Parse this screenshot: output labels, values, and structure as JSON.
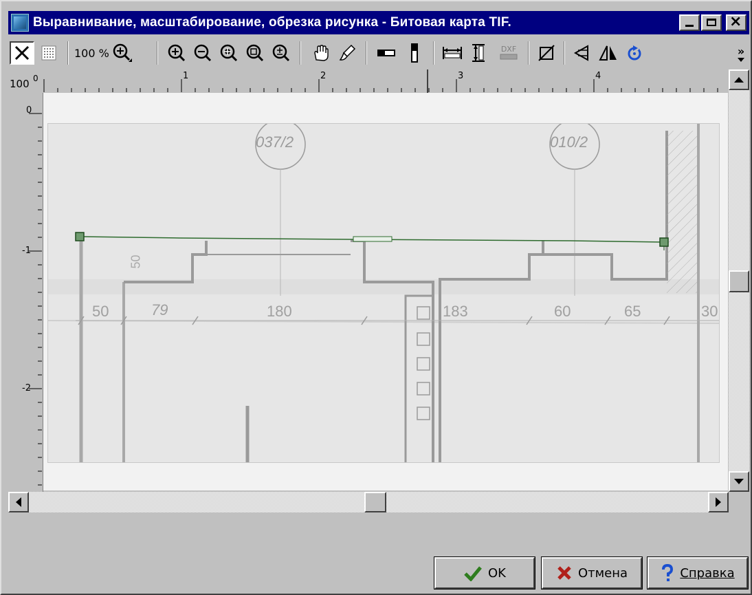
{
  "window": {
    "title": "Выравнивание, масштабирование, обрезка рисунка - Битовая карта TIF."
  },
  "toolbar": {
    "zoom_label": "100 %",
    "dxf_label": "DXF",
    "tools": [
      "cross-tool",
      "grid-tool",
      "zoom-100-tool",
      "zoom-in-tool",
      "zoom-out-tool",
      "zoom-fit-tool",
      "zoom-window-tool",
      "zoom-plusminus-tool",
      "pan-hand-tool",
      "brush-tool",
      "horizontal-align-tool",
      "vertical-align-tool",
      "horizontal-measure-tool",
      "vertical-measure-tool",
      "dxf-tool",
      "crop-tool",
      "mirror-vertical-tool",
      "mirror-horizontal-tool",
      "rotate-tool"
    ],
    "overflow_label": "»"
  },
  "ruler": {
    "corner_label": "100",
    "corner_sub": "0",
    "h_labels": [
      "1",
      "2",
      "3",
      "4"
    ],
    "v_labels": [
      "0",
      "-1",
      "-2"
    ]
  },
  "drawing": {
    "bubble_labels": [
      "037/2",
      "010/2"
    ],
    "dimension_labels": [
      "50",
      "79",
      "180",
      "183",
      "60",
      "65",
      "30"
    ],
    "side_label": "50"
  },
  "buttons": {
    "ok": "OK",
    "cancel": "Отмена",
    "help": "Справка"
  }
}
